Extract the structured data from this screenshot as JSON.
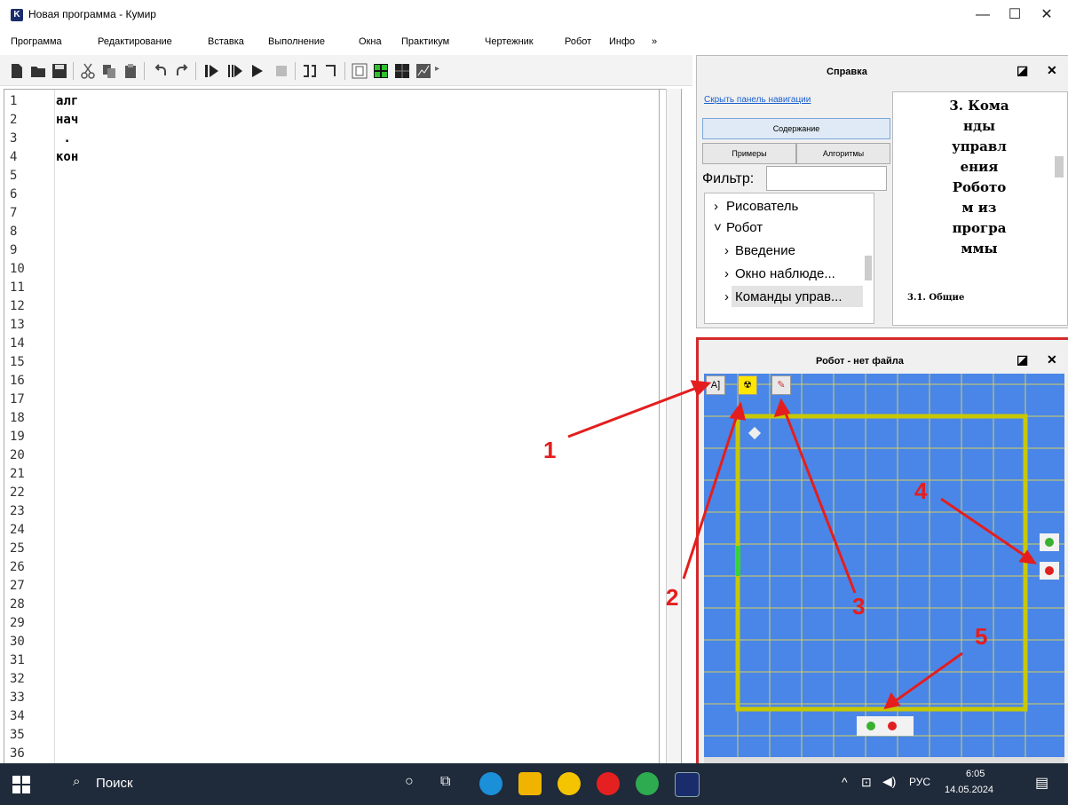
{
  "window": {
    "title": "Новая программа - Кумир",
    "app_icon_letter": "K",
    "minimize": "—",
    "maximize": "☐",
    "close": "✕"
  },
  "menu": [
    "Программа",
    "Редактирование",
    "Вставка",
    "Выполнение",
    "Окна",
    "Практикум",
    "Чертежник",
    "Робот",
    "Инфо",
    "»"
  ],
  "editor": {
    "line_numbers": [
      "1",
      "2",
      "3",
      "4",
      "5",
      "6",
      "7",
      "8",
      "9",
      "10",
      "11",
      "12",
      "13",
      "14",
      "15",
      "16",
      "17",
      "18",
      "19",
      "20",
      "21",
      "22",
      "23",
      "24",
      "25",
      "26",
      "27",
      "28",
      "29",
      "30",
      "31",
      "32",
      "33",
      "34",
      "35",
      "36"
    ],
    "code_lines": [
      "алг",
      "нач",
      " .",
      "кон"
    ]
  },
  "help_panel": {
    "title": "Справка",
    "hide_nav_link": "Скрыть панель навигации",
    "tab_contents": "Содержание",
    "tab_examples": "Примеры",
    "tab_algorithms": "Алгоритмы",
    "filter_label": "Фильтр:",
    "tree": [
      {
        "label": "Рисователь",
        "arrow": "›"
      },
      {
        "label": "Робот",
        "arrow": "˅"
      },
      {
        "label": "Введение",
        "arrow": "›"
      },
      {
        "label": "Окно наблюде...",
        "arrow": "›"
      },
      {
        "label": "Команды управ...",
        "arrow": "›"
      }
    ],
    "heading_lines": [
      "3. Кома",
      "нды",
      "управл",
      "ения",
      "Робото",
      "м из",
      "програ",
      "ммы"
    ],
    "subheading": "3.1. Общие"
  },
  "robot_panel": {
    "title": "Робот - нет файла",
    "btn_text": "A]",
    "grid_cols": 11,
    "grid_rows": 14,
    "colors": {
      "field": "#4a86e8",
      "wall": "#c8c800",
      "grid": "#d6cf5a",
      "annotation": "#e41e1e"
    }
  },
  "annotations": [
    "1",
    "2",
    "3",
    "4",
    "5"
  ],
  "taskbar": {
    "search_placeholder": "Поиск",
    "lang": "РУС",
    "time": "6:05",
    "date": "14.05.2024"
  }
}
